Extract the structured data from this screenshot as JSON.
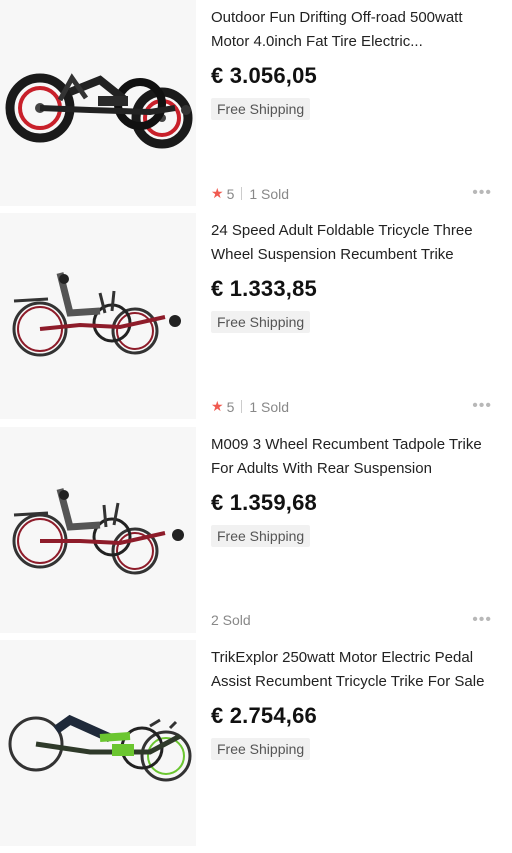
{
  "products": [
    {
      "title": "Outdoor Fun Drifting Off-road 500watt Motor 4.0inch Fat Tire Electric...",
      "price": "€ 3.056,05",
      "shipping": "Free Shipping",
      "rating": "5",
      "sold": "1 Sold",
      "image": "fat-tire-electric-trike-image",
      "frame_color": "#222222",
      "rim_color": "#d0242a"
    },
    {
      "title": "24 Speed Adult Foldable Tricycle Three Wheel Suspension Recumbent Trike",
      "price": "€ 1.333,85",
      "shipping": "Free Shipping",
      "rating": "5",
      "sold": "1 Sold",
      "image": "red-recumbent-trike-image",
      "frame_color": "#8e1c2a",
      "rim_color": "#8e1c2a"
    },
    {
      "title": "M009 3 Wheel Recumbent  Tadpole Trike For Adults With Rear Suspension",
      "price": "€ 1.359,68",
      "shipping": "Free Shipping",
      "rating": "",
      "sold": "2 Sold",
      "image": "tadpole-trike-image",
      "frame_color": "#8e1c2a",
      "rim_color": "#8e1c2a"
    },
    {
      "title": "TrikExplor 250watt Motor Electric Pedal Assist Recumbent Tricycle Trike For Sale",
      "price": "€ 2.754,66",
      "shipping": "Free Shipping",
      "image": "green-electric-trike-image",
      "frame_color": "#2f3a2a",
      "rim_color": "#6bc630"
    }
  ],
  "star_color": "#f05a50",
  "more_glyph": "•••"
}
